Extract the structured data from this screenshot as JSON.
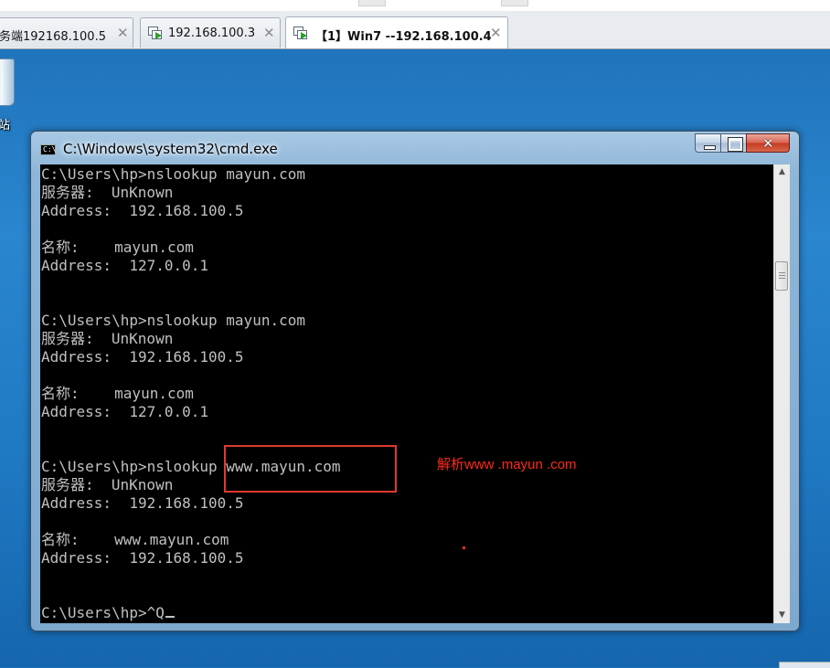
{
  "tabs": [
    {
      "label": "务端192168.100.5",
      "close": "✕",
      "icon": "none",
      "active": false
    },
    {
      "label": "192.168.100.3",
      "close": "✕",
      "icon": "vm-play-icon",
      "active": false
    },
    {
      "label": "【1】Win7 --192.168.100.4",
      "close": "✕",
      "icon": "vm-play-icon",
      "active": true
    }
  ],
  "desktop": {
    "recycle_label": "站"
  },
  "window": {
    "title": "C:\\Windows\\system32\\cmd.exe",
    "icon": "cmd-icon",
    "controls": [
      "minimize",
      "maximize",
      "close"
    ]
  },
  "console": {
    "lines": [
      "C:\\Users\\hp>nslookup mayun.com",
      "服务器:  UnKnown",
      "Address:  192.168.100.5",
      "",
      "名称:    mayun.com",
      "Address:  127.0.0.1",
      "",
      "",
      "C:\\Users\\hp>nslookup mayun.com",
      "服务器:  UnKnown",
      "Address:  192.168.100.5",
      "",
      "名称:    mayun.com",
      "Address:  127.0.0.1",
      "",
      "",
      "C:\\Users\\hp>nslookup www.mayun.com",
      "服务器:  UnKnown",
      "Address:  192.168.100.5",
      "",
      "名称:    www.mayun.com",
      "Address:  192.168.100.5",
      "",
      "",
      "C:\\Users\\hp>^Q"
    ],
    "text_color": "#c0c0c0",
    "background": "#000000"
  },
  "annotation": {
    "note": "解析www .mayun .com",
    "color": "#ff2a1a"
  }
}
